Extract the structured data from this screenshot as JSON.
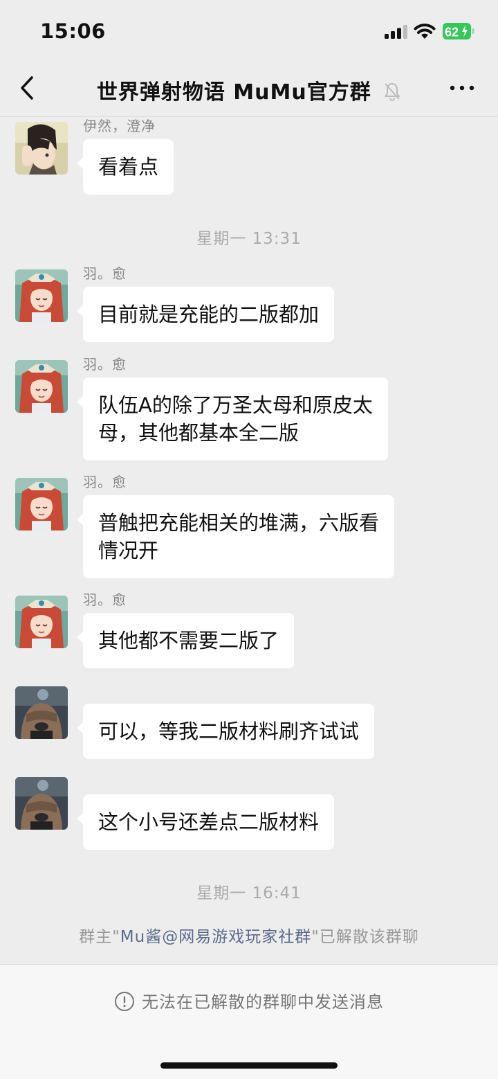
{
  "status_bar": {
    "time": "15:06",
    "battery": "62"
  },
  "nav": {
    "title": "世界弹射物语 MuMu官方群"
  },
  "messages": [
    {
      "sender": "伊然，澄净",
      "text": "看着点"
    },
    {
      "sender": "羽。愈",
      "text": "目前就是充能的二版都加"
    },
    {
      "sender": "羽。愈",
      "text_line1": "队伍A的除了万圣太母和原皮太",
      "text_line2": "母，其他都基本全二版"
    },
    {
      "sender": "羽。愈",
      "text_line1": "普触把充能相关的堆满，六版看",
      "text_line2": "情况开"
    },
    {
      "sender": "羽。愈",
      "text": "其他都不需要二版了"
    },
    {
      "sender": "",
      "text": "可以，等我二版材料刷齐试试"
    },
    {
      "sender": "",
      "text": "这个小号还差点二版材料"
    }
  ],
  "timestamps": {
    "t1": "星期一 13:31",
    "t2": "星期一 16:41"
  },
  "system": {
    "prefix": "群主\"",
    "owner": "Mu酱@网易游戏玩家社群",
    "suffix": "\"已解散该群聊"
  },
  "bottom": {
    "notice": "无法在已解散的群聊中发送消息"
  },
  "colors": {
    "background": "#ededed",
    "bubble": "#ffffff",
    "link": "#5b6b8c",
    "battery": "#34c759"
  }
}
